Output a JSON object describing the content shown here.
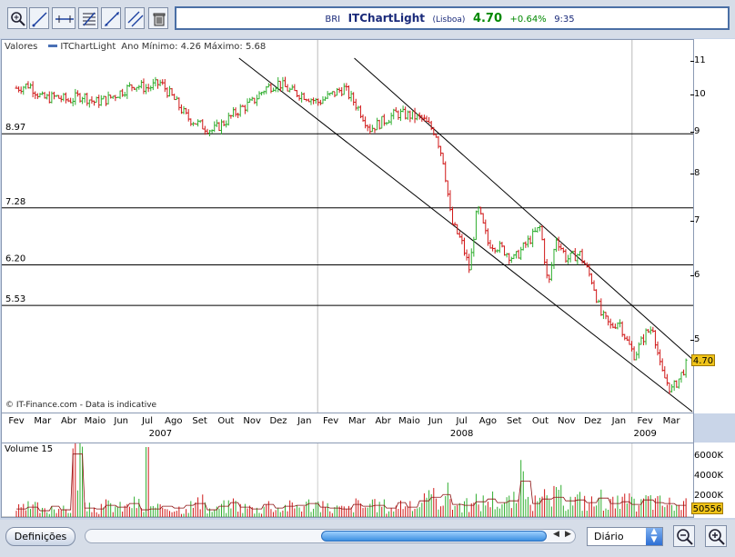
{
  "ticker": {
    "symbol": "BRI",
    "name": "ITChartLight",
    "exchange": "(Lisboa)",
    "price": "4.70",
    "change": "+0.64%",
    "time": "9:35"
  },
  "toolbar": {
    "tools": [
      "zoom-icon",
      "trendline-icon",
      "horizontal-line-icon",
      "fibonacci-icon",
      "channel-icon",
      "parallel-lines-icon",
      "trash-icon"
    ]
  },
  "legend": {
    "label": "Valores",
    "series": "ITChartLight",
    "range": "Ano Mínimo: 4.26 Máximo: 5.68"
  },
  "credit": "© IT-Finance.com - Data is indicative",
  "chart_data": {
    "type": "bar",
    "title": "",
    "series": [
      {
        "name": "ITChartLight"
      }
    ],
    "y_ticks": [
      "11",
      "10",
      "9",
      "8",
      "7",
      "6",
      "5"
    ],
    "y_scale": "log",
    "ylim": [
      4.1,
      11.1
    ],
    "x_months": [
      "Fev",
      "Mar",
      "Abr",
      "Maio",
      "Jun",
      "Jul",
      "Ago",
      "Set",
      "Out",
      "Nov",
      "Dez",
      "Jan",
      "Fev",
      "Mar",
      "Abr",
      "Maio",
      "Jun",
      "Jul",
      "Ago",
      "Set",
      "Out",
      "Nov",
      "Dez",
      "Jan",
      "Fev",
      "Mar"
    ],
    "x_years": [
      {
        "label": "2007",
        "month_index": 5.5
      },
      {
        "label": "2008",
        "month_index": 17
      },
      {
        "label": "2009",
        "month_index": 24
      }
    ],
    "horizontal_levels": [
      {
        "value": 8.97,
        "label": "8.97"
      },
      {
        "value": 7.28,
        "label": "7.28"
      },
      {
        "value": 6.2,
        "label": "6.20"
      },
      {
        "value": 5.53,
        "label": "5.53"
      }
    ],
    "channel_lines": [
      {
        "start": [
          8.5,
          11.1
        ],
        "end": [
          25.8,
          4.1
        ]
      },
      {
        "start": [
          12.9,
          11.1
        ],
        "end": [
          26.3,
          4.6
        ]
      }
    ],
    "close_by_month": [
      [
        0,
        10.2
      ],
      [
        0.5,
        10.3
      ],
      [
        1,
        9.9
      ],
      [
        1.5,
        9.95
      ],
      [
        2,
        9.85
      ],
      [
        2.5,
        10.0
      ],
      [
        3,
        9.8
      ],
      [
        3.5,
        9.9
      ],
      [
        4,
        10.1
      ],
      [
        4.5,
        10.3
      ],
      [
        5,
        10.2
      ],
      [
        5.5,
        10.35
      ],
      [
        6,
        9.9
      ],
      [
        6.5,
        9.4
      ],
      [
        7,
        9.2
      ],
      [
        7.5,
        9.05
      ],
      [
        8,
        9.3
      ],
      [
        8.5,
        9.6
      ],
      [
        9,
        9.8
      ],
      [
        9.5,
        10.2
      ],
      [
        10,
        10.35
      ],
      [
        10.5,
        10.1
      ],
      [
        11,
        10.0
      ],
      [
        11.5,
        9.8
      ],
      [
        12,
        10.0
      ],
      [
        12.5,
        10.2
      ],
      [
        13,
        9.7
      ],
      [
        13.5,
        9.1
      ],
      [
        14,
        9.3
      ],
      [
        14.5,
        9.5
      ],
      [
        15,
        9.45
      ],
      [
        15.5,
        9.35
      ],
      [
        16,
        9.0
      ],
      [
        16.3,
        8.3
      ],
      [
        16.6,
        7.0
      ],
      [
        17,
        6.6
      ],
      [
        17.3,
        6.1
      ],
      [
        17.6,
        7.3
      ],
      [
        18,
        6.6
      ],
      [
        18.5,
        6.5
      ],
      [
        19,
        6.3
      ],
      [
        19.5,
        6.6
      ],
      [
        20,
        6.9
      ],
      [
        20.3,
        5.8
      ],
      [
        20.6,
        6.7
      ],
      [
        21,
        6.3
      ],
      [
        21.5,
        6.4
      ],
      [
        22,
        5.9
      ],
      [
        22.3,
        5.4
      ],
      [
        22.7,
        5.2
      ],
      [
        23,
        5.3
      ],
      [
        23.3,
        5.0
      ],
      [
        23.6,
        4.8
      ],
      [
        24,
        5.1
      ],
      [
        24.3,
        5.2
      ],
      [
        24.6,
        4.6
      ],
      [
        25,
        4.35
      ],
      [
        25.3,
        4.5
      ],
      [
        25.6,
        4.7
      ]
    ]
  },
  "volume": {
    "title": "Volume 15",
    "ticks": [
      "6000K",
      "4000K",
      "2000K"
    ],
    "current": "50556",
    "ylim": [
      0,
      7000
    ],
    "samples": [
      900,
      1100,
      700,
      1200,
      800,
      7000,
      1000,
      900,
      1300,
      1100,
      1500,
      800,
      900,
      1200,
      1000,
      1300,
      1500,
      800,
      1200,
      1600,
      1100,
      900,
      1400,
      1000,
      1200,
      1300,
      1500,
      1100,
      1000,
      900,
      1400,
      1200,
      1300,
      1000,
      1600,
      1100,
      1800,
      2200,
      2500,
      1400,
      1300,
      1700,
      2000,
      1600,
      1800,
      4000,
      1500,
      2000,
      2200,
      1800,
      1900,
      1600,
      2100,
      1500,
      1700,
      1400,
      1900,
      1600,
      1500,
      1300
    ]
  },
  "current_price": "4.70",
  "bottom": {
    "settings_label": "Definições",
    "period": "Diário"
  }
}
